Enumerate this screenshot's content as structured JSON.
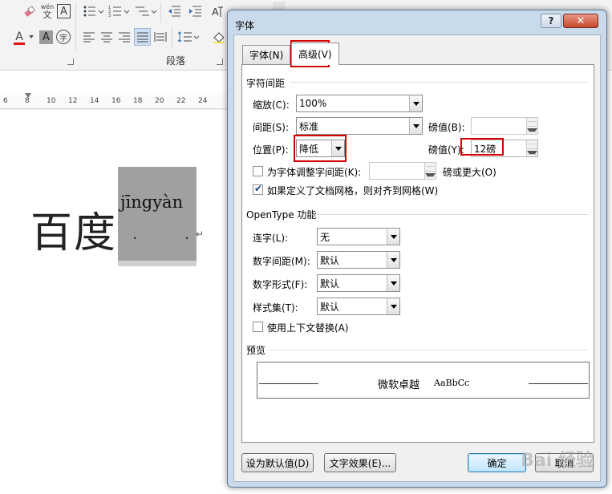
{
  "word": {
    "group_label": "段落",
    "ruler_ticks": [
      "6",
      "8",
      "10",
      "12",
      "14",
      "16",
      "18",
      "20",
      "22",
      "24"
    ],
    "doc_text": "百度",
    "pinyin": "jīngyàn",
    "dots": "· · ·",
    "para_mark": "↵",
    "pinyin_btn_wen": "wén",
    "pinyin_btn_zi": "文",
    "char_border_letter": "A",
    "shade_letter": "A",
    "circle_char": "字",
    "font_color_letter": "A"
  },
  "dialog": {
    "title": "字体",
    "help_label": "?",
    "close_label": "✕",
    "tabs": [
      {
        "label": "字体(N)",
        "active": false
      },
      {
        "label": "高级(V)",
        "active": true
      }
    ],
    "spacing": {
      "section": "字符间距",
      "scale_label": "缩放(C):",
      "scale_value": "100%",
      "spacing_label": "间距(S):",
      "spacing_value": "标准",
      "spacing_by_label": "磅值(B):",
      "spacing_by_value": "",
      "position_label": "位置(P):",
      "position_value": "降低",
      "position_by_label": "磅值(Y):",
      "position_by_value": "12磅",
      "kerning_label": "为字体调整字间距(K):",
      "kerning_value": "",
      "kerning_suffix": "磅或更大(O)",
      "kerning_checked": false,
      "grid_label": "如果定义了文档网格，则对齐到网格(W)",
      "grid_checked": true
    },
    "opentype": {
      "section": "OpenType 功能",
      "ligatures_label": "连字(L):",
      "ligatures_value": "无",
      "num_spacing_label": "数字间距(M):",
      "num_spacing_value": "默认",
      "num_forms_label": "数字形式(F):",
      "num_forms_value": "默认",
      "stylistic_label": "样式集(T):",
      "stylistic_value": "默认",
      "contextual_label": "使用上下文替换(A)",
      "contextual_checked": false
    },
    "preview": {
      "section": "预览",
      "sample_cn": "微软卓越",
      "sample_latin": "AaBbCc"
    },
    "buttons": {
      "set_default": "设为默认值(D)",
      "text_effects": "文字效果(E)...",
      "ok": "确定",
      "cancel": "取消"
    },
    "watermark": "Bai 经验"
  }
}
